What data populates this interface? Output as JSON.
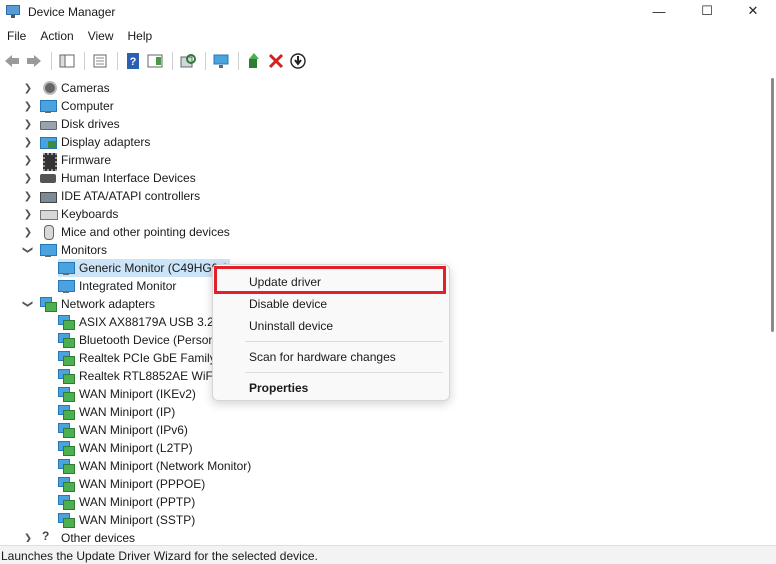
{
  "window": {
    "title": "Device Manager",
    "controls": {
      "minimize": "—",
      "maximize": "☐",
      "close": "✕"
    }
  },
  "menubar": [
    "File",
    "Action",
    "View",
    "Help"
  ],
  "toolbar_icons": [
    "back-icon",
    "forward-icon",
    "show-hide-console-tree-icon",
    "properties-icon",
    "help-icon",
    "action-pane-icon",
    "scan-hardware-icon",
    "monitor-icon",
    "update-driver-icon",
    "uninstall-icon",
    "download-icon"
  ],
  "tree": {
    "categories": [
      {
        "label": "Cameras",
        "icon": "camera-icon",
        "expanded": false
      },
      {
        "label": "Computer",
        "icon": "monitor-icon",
        "expanded": false
      },
      {
        "label": "Disk drives",
        "icon": "disk-icon",
        "expanded": false
      },
      {
        "label": "Display adapters",
        "icon": "display-adapter-icon",
        "expanded": false
      },
      {
        "label": "Firmware",
        "icon": "chip-icon",
        "expanded": false
      },
      {
        "label": "Human Interface Devices",
        "icon": "hid-icon",
        "expanded": false
      },
      {
        "label": "IDE ATA/ATAPI controllers",
        "icon": "ide-icon",
        "expanded": false
      },
      {
        "label": "Keyboards",
        "icon": "keyboard-icon",
        "expanded": false
      },
      {
        "label": "Mice and other pointing devices",
        "icon": "mouse-icon",
        "expanded": false
      },
      {
        "label": "Monitors",
        "icon": "monitor-icon",
        "expanded": true
      },
      {
        "label": "Network adapters",
        "icon": "network-icon",
        "expanded": true
      },
      {
        "label": "Other devices",
        "icon": "other-device-icon",
        "expanded": false
      }
    ],
    "monitors": [
      "Generic Monitor (C49HG9x)",
      "Integrated Monitor"
    ],
    "network_adapters": [
      "ASIX AX88179A USB 3.2 G",
      "Bluetooth Device (Person",
      "Realtek PCIe GbE Family",
      "Realtek RTL8852AE WiFi 6",
      "WAN Miniport (IKEv2)",
      "WAN Miniport (IP)",
      "WAN Miniport (IPv6)",
      "WAN Miniport (L2TP)",
      "WAN Miniport (Network Monitor)",
      "WAN Miniport (PPPOE)",
      "WAN Miniport (PPTP)",
      "WAN Miniport (SSTP)"
    ]
  },
  "context_menu": {
    "update_driver": "Update driver",
    "disable_device": "Disable device",
    "uninstall_device": "Uninstall device",
    "scan_hardware": "Scan for hardware changes",
    "properties": "Properties"
  },
  "colors": {
    "highlight": "#e0202a",
    "selection": "#cce4f7"
  },
  "status": "Launches the Update Driver Wizard for the selected device."
}
